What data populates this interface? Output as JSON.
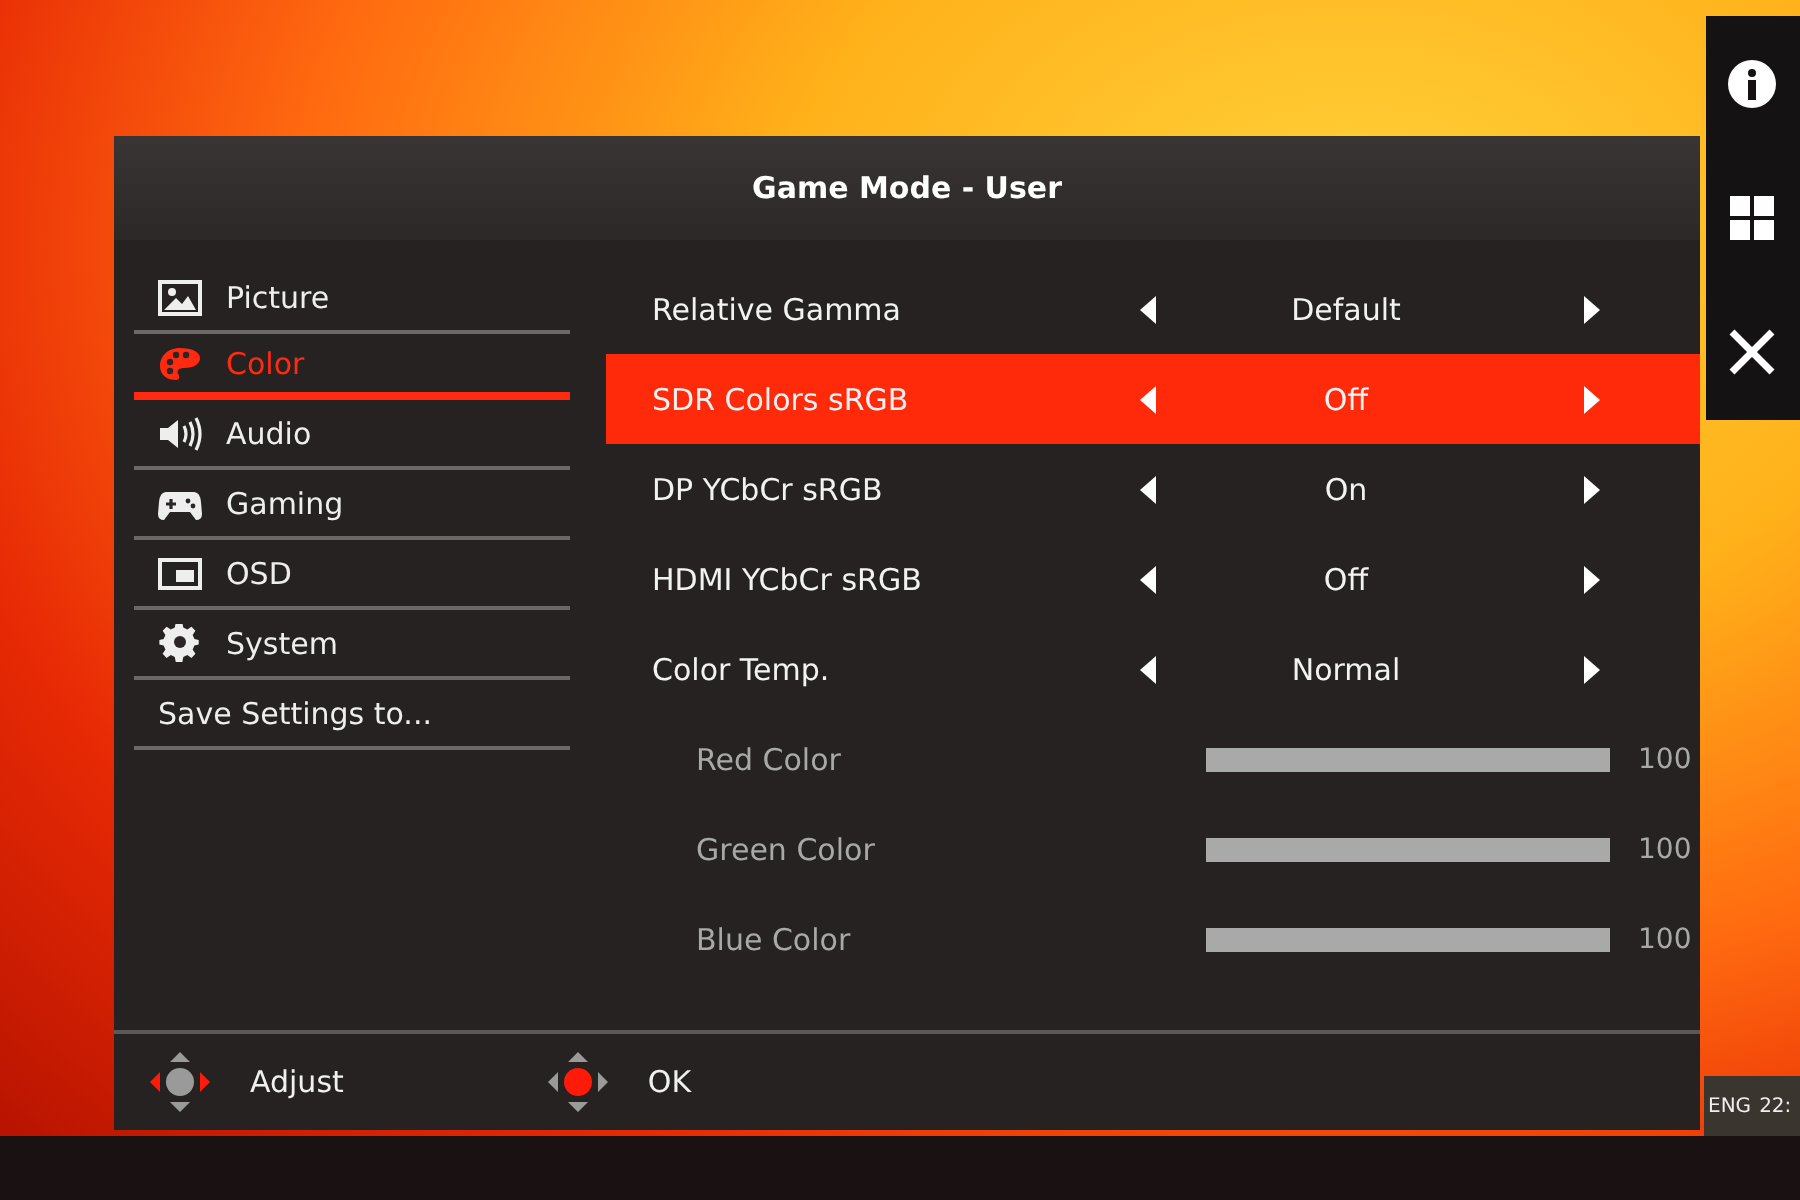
{
  "window": {
    "title": "Game Mode - User"
  },
  "sidebar": {
    "items": [
      {
        "label": "Picture",
        "kind": "picture",
        "selected": false
      },
      {
        "label": "Color",
        "kind": "palette",
        "selected": true
      },
      {
        "label": "Audio",
        "kind": "speaker",
        "selected": false
      },
      {
        "label": "Gaming",
        "kind": "gamepad",
        "selected": false
      },
      {
        "label": "OSD",
        "kind": "osd",
        "selected": false
      },
      {
        "label": "System",
        "kind": "gear",
        "selected": false
      },
      {
        "label": "Save Settings to...",
        "kind": "plain",
        "selected": false
      }
    ]
  },
  "rows": [
    {
      "kind": "option",
      "label": "Relative Gamma",
      "value": "Default",
      "selected": false,
      "disabled": false
    },
    {
      "kind": "option",
      "label": "SDR Colors sRGB",
      "value": "Off",
      "selected": true,
      "disabled": false
    },
    {
      "kind": "option",
      "label": "DP YCbCr sRGB",
      "value": "On",
      "selected": false,
      "disabled": false
    },
    {
      "kind": "option",
      "label": "HDMI YCbCr sRGB",
      "value": "Off",
      "selected": false,
      "disabled": false
    },
    {
      "kind": "option",
      "label": "Color Temp.",
      "value": "Normal",
      "selected": false,
      "disabled": false
    },
    {
      "kind": "slider",
      "label": "Red Color",
      "level": 1,
      "reading": "100",
      "selected": false,
      "disabled": true
    },
    {
      "kind": "slider",
      "label": "Green Color",
      "level": 1,
      "reading": "100",
      "selected": false,
      "disabled": true
    },
    {
      "kind": "slider",
      "label": "Blue Color",
      "level": 1,
      "reading": "100",
      "selected": false,
      "disabled": true
    }
  ],
  "footer": [
    {
      "kind": "adjust",
      "label": "Adjust"
    },
    {
      "kind": "ok",
      "label": "OK"
    }
  ],
  "taskbar": {
    "language": "ENG",
    "clock": "22:"
  }
}
